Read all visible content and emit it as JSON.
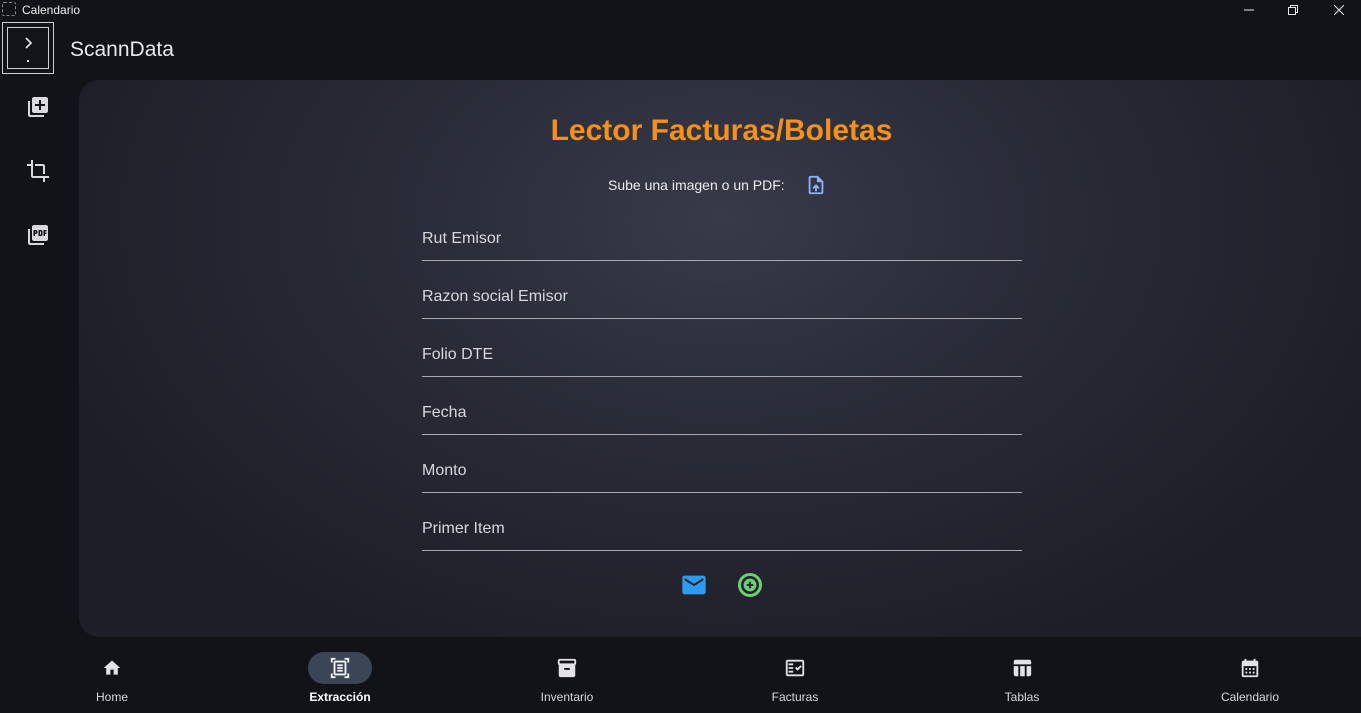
{
  "window": {
    "title": "Calendario"
  },
  "header": {
    "app_title": "ScannData"
  },
  "rail": {
    "items": [
      "document-plus-icon",
      "crop-icon",
      "pdf-icon"
    ]
  },
  "main": {
    "title": "Lector Facturas/Boletas",
    "upload_label": "Sube una imagen o un PDF:",
    "fields": [
      {
        "placeholder": "Rut Emisor",
        "value": ""
      },
      {
        "placeholder": "Razon social Emisor",
        "value": ""
      },
      {
        "placeholder": "Folio DTE",
        "value": ""
      },
      {
        "placeholder": "Fecha",
        "value": ""
      },
      {
        "placeholder": "Monto",
        "value": ""
      },
      {
        "placeholder": "Primer Item",
        "value": ""
      }
    ],
    "actions": [
      "mail-icon",
      "add-circle-icon"
    ]
  },
  "nav": {
    "active": "Extracción",
    "items": [
      {
        "label": "Home",
        "icon": "home-icon"
      },
      {
        "label": "Extracción",
        "icon": "document-scanner-icon"
      },
      {
        "label": "Inventario",
        "icon": "archive-icon"
      },
      {
        "label": "Facturas",
        "icon": "fact-check-icon"
      },
      {
        "label": "Tablas",
        "icon": "table-icon"
      },
      {
        "label": "Calendario",
        "icon": "calendar-icon"
      }
    ]
  },
  "colors": {
    "accent_title": "#f5901b",
    "upload_icon": "#8ab4f8",
    "mail_icon": "#2f9bf0",
    "add_icon": "#6ccf73",
    "nav_active_pill": "#3b4556"
  }
}
